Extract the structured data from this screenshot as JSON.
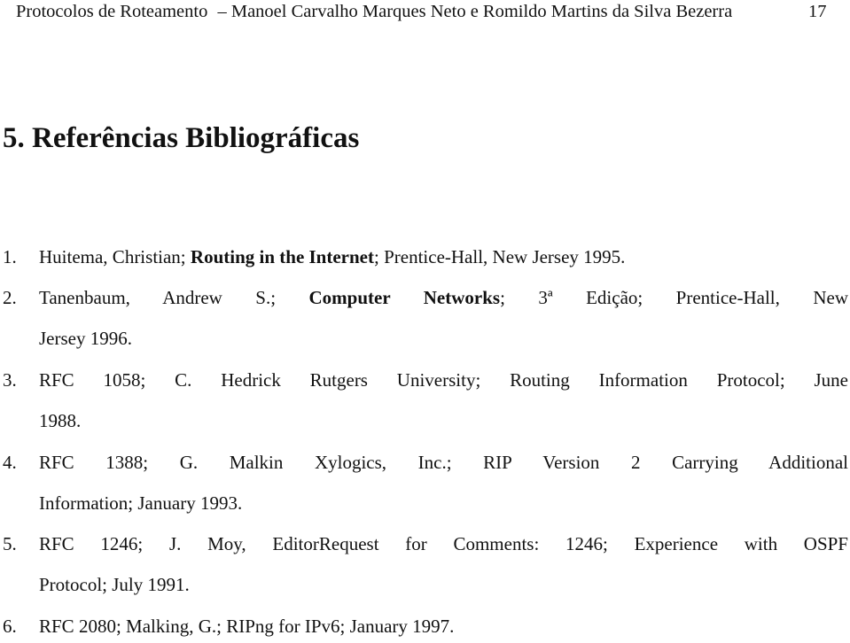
{
  "header": {
    "running_title": "Protocolos de Roteamento",
    "separator": "–",
    "authors": "Manoel Carvalho Marques Neto e Romildo Martins da Silva Bezerra",
    "page_number": "17"
  },
  "section": {
    "title": "5. Referências Bibliográficas"
  },
  "references": [
    {
      "number": "1.",
      "line1": {
        "pre": "Huitema, Christian; ",
        "bold": "Routing in the Internet",
        "post": "; Prentice-Hall, New Jersey 1995."
      }
    },
    {
      "number": "2.",
      "line1": {
        "pre": "Tanenbaum, Andrew S.; ",
        "bold": "Computer Networks",
        "post": "; 3ª Edição; Prentice-Hall, New"
      },
      "line2": "Jersey 1996."
    },
    {
      "number": "3.",
      "line1": "RFC 1058; C. Hedrick Rutgers University; Routing Information Protocol; June",
      "line2": "1988."
    },
    {
      "number": "4.",
      "line1": "RFC 1388; G. Malkin Xylogics, Inc.; RIP Version 2 Carrying Additional",
      "line2": "Information; January 1993."
    },
    {
      "number": "5.",
      "line1": "RFC 1246; J. Moy, EditorRequest for Comments: 1246; Experience with OSPF",
      "line2": "Protocol; July 1991."
    },
    {
      "number": "6.",
      "line1": "RFC 2080; Malking, G.; RIPng for IPv6; January 1997."
    }
  ]
}
